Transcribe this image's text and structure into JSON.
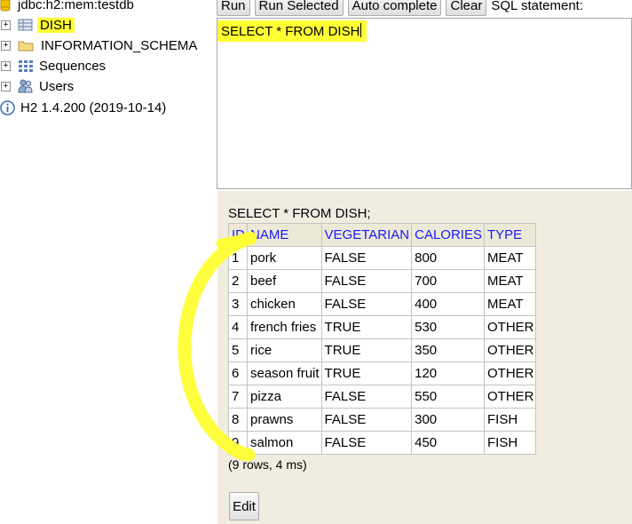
{
  "tree": {
    "connection": {
      "label": "jdbc:h2:mem:testdb"
    },
    "items": [
      {
        "label": "DISH",
        "expander": "+"
      },
      {
        "label": "INFORMATION_SCHEMA",
        "expander": "+"
      },
      {
        "label": "Sequences",
        "expander": "+"
      },
      {
        "label": "Users",
        "expander": "+"
      }
    ],
    "version": {
      "label": "H2 1.4.200 (2019-10-14)"
    }
  },
  "toolbar": {
    "run_label": "Run",
    "run_selected_label": "Run Selected",
    "auto_complete_label": "Auto complete",
    "clear_label": "Clear",
    "sql_statement_label": "SQL statement:"
  },
  "editor": {
    "value": "SELECT * FROM DISH"
  },
  "result": {
    "query": "SELECT * FROM DISH;",
    "columns": [
      "ID",
      "NAME",
      "VEGETARIAN",
      "CALORIES",
      "TYPE"
    ],
    "rows": [
      [
        "1",
        "pork",
        "FALSE",
        "800",
        "MEAT"
      ],
      [
        "2",
        "beef",
        "FALSE",
        "700",
        "MEAT"
      ],
      [
        "3",
        "chicken",
        "FALSE",
        "400",
        "MEAT"
      ],
      [
        "4",
        "french fries",
        "TRUE",
        "530",
        "OTHER"
      ],
      [
        "5",
        "rice",
        "TRUE",
        "350",
        "OTHER"
      ],
      [
        "6",
        "season fruit",
        "TRUE",
        "120",
        "OTHER"
      ],
      [
        "7",
        "pizza",
        "FALSE",
        "550",
        "OTHER"
      ],
      [
        "8",
        "prawns",
        "FALSE",
        "300",
        "FISH"
      ],
      [
        "9",
        "salmon",
        "FALSE",
        "450",
        "FISH"
      ]
    ],
    "status": "(9 rows, 4 ms)",
    "edit_label": "Edit"
  },
  "colors": {
    "highlight": "#ffff33",
    "result_bg": "#f0ede0",
    "header_text": "#1a1aff"
  }
}
